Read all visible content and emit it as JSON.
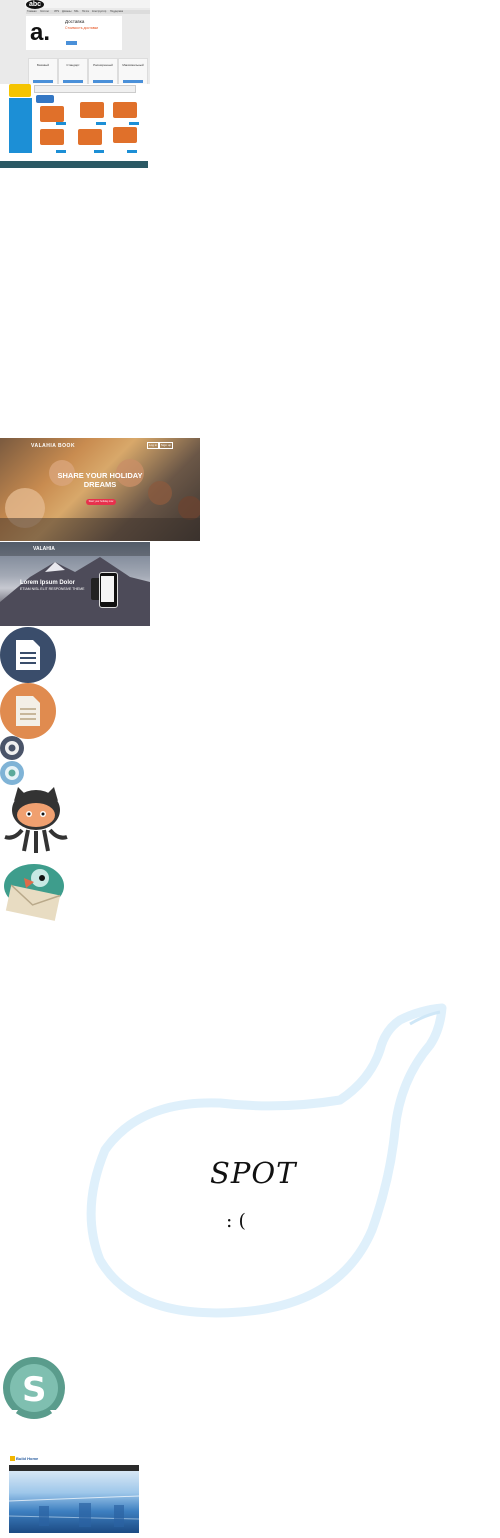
{
  "abc": {
    "logo": "abc",
    "big_letter": "a.",
    "heading": "Доставка",
    "subline": "Стоимость доставки",
    "nav": [
      "Главная",
      "Хостинг",
      "VPS",
      "Домены",
      "SSL",
      "Почта",
      "Конструктор",
      "Поддержка"
    ],
    "plans": [
      "Базовый",
      "Стандарт",
      "Расширенный",
      "Максимальный"
    ]
  },
  "shop": {
    "product_colors": [
      "#3477c4",
      "#e0702a",
      "#e0702a",
      "#e0702a",
      "#e0702a",
      "#e0702a"
    ]
  },
  "holiday": {
    "brand": "VALAHIA BOOK",
    "login": "Log in",
    "signup": "Sign up",
    "headline": "SHARE YOUR HOLIDAY DREAMS",
    "cta": "Start your holiday now"
  },
  "mountain": {
    "brand": "VALAHIA",
    "headline": "Lorem Ipsum Dolor",
    "subheadline": "ETIAM NISL ELIT RESPONSIVE THEME"
  },
  "bubble": {
    "title": "SPOT",
    "face": ": ("
  },
  "build": {
    "title": "Build Home"
  },
  "colors": {
    "doc_dark": "#3a4d6b",
    "doc_orange": "#e08b4f",
    "bubble_outline": "#cfe7f7",
    "octocat": "#f0a070",
    "skype_green": "#5a9c8c"
  }
}
